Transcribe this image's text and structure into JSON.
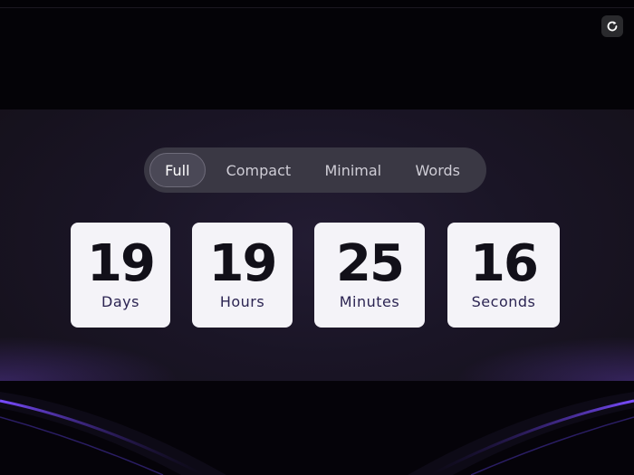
{
  "tabs": [
    {
      "label": "Full",
      "active": true
    },
    {
      "label": "Compact",
      "active": false
    },
    {
      "label": "Minimal",
      "active": false
    },
    {
      "label": "Words",
      "active": false
    }
  ],
  "countdown": [
    {
      "value": "19",
      "unit": "Days"
    },
    {
      "value": "19",
      "unit": "Hours"
    },
    {
      "value": "25",
      "unit": "Minutes"
    },
    {
      "value": "16",
      "unit": "Seconds"
    }
  ],
  "icons": {
    "refresh": "refresh-icon"
  },
  "colors": {
    "accent": "#6a3fe0",
    "card_bg": "#f4f3f8",
    "label": "#2b2452"
  }
}
